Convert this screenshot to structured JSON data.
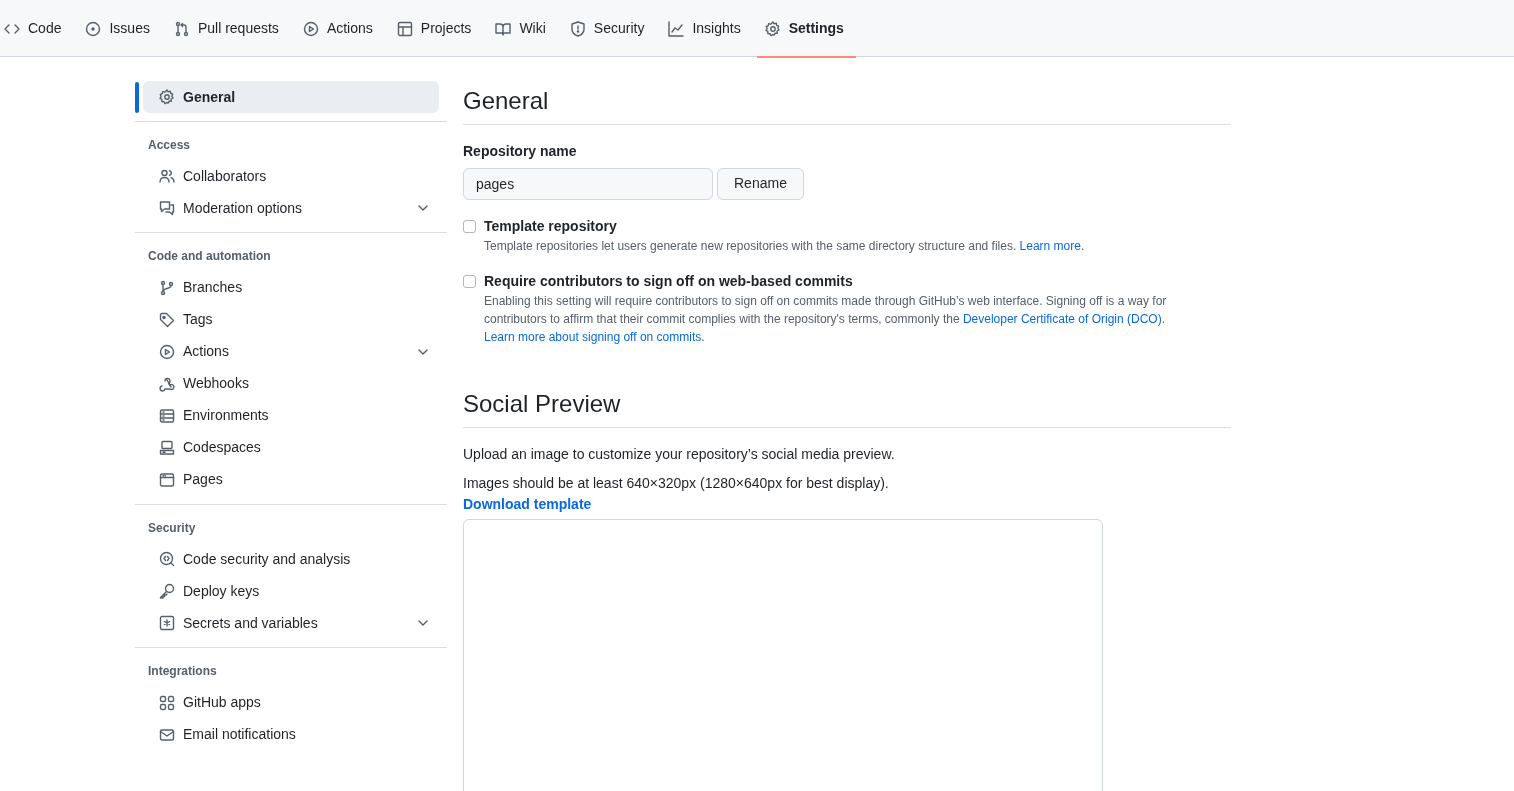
{
  "tabs": [
    {
      "label": "Code",
      "selected": false
    },
    {
      "label": "Issues",
      "selected": false
    },
    {
      "label": "Pull requests",
      "selected": false
    },
    {
      "label": "Actions",
      "selected": false
    },
    {
      "label": "Projects",
      "selected": false
    },
    {
      "label": "Wiki",
      "selected": false
    },
    {
      "label": "Security",
      "selected": false
    },
    {
      "label": "Insights",
      "selected": false
    },
    {
      "label": "Settings",
      "selected": true
    }
  ],
  "sidebar": {
    "top_item": {
      "label": "General",
      "selected": true
    },
    "groups": [
      {
        "heading": "Access",
        "items": [
          {
            "label": "Collaborators",
            "selected": false,
            "has_submenu": false
          },
          {
            "label": "Moderation options",
            "selected": false,
            "has_submenu": true
          }
        ]
      },
      {
        "heading": "Code and automation",
        "items": [
          {
            "label": "Branches",
            "selected": false,
            "has_submenu": false
          },
          {
            "label": "Tags",
            "selected": false,
            "has_submenu": false
          },
          {
            "label": "Actions",
            "selected": false,
            "has_submenu": true
          },
          {
            "label": "Webhooks",
            "selected": false,
            "has_submenu": false
          },
          {
            "label": "Environments",
            "selected": false,
            "has_submenu": false
          },
          {
            "label": "Codespaces",
            "selected": false,
            "has_submenu": false
          },
          {
            "label": "Pages",
            "selected": false,
            "has_submenu": false
          }
        ]
      },
      {
        "heading": "Security",
        "items": [
          {
            "label": "Code security and analysis",
            "selected": false,
            "has_submenu": false
          },
          {
            "label": "Deploy keys",
            "selected": false,
            "has_submenu": false
          },
          {
            "label": "Secrets and variables",
            "selected": false,
            "has_submenu": true
          }
        ]
      },
      {
        "heading": "Integrations",
        "items": [
          {
            "label": "GitHub apps",
            "selected": false,
            "has_submenu": false
          },
          {
            "label": "Email notifications",
            "selected": false,
            "has_submenu": false
          }
        ]
      }
    ]
  },
  "general": {
    "title": "General",
    "repo_name_label": "Repository name",
    "repo_name_value": "pages",
    "rename_button": "Rename",
    "options": [
      {
        "label": "Template repository",
        "checked": false,
        "lines": [
          [
            {
              "kind": "text",
              "text": "Template repositories let users generate new repositories with the same directory structure and files. "
            },
            {
              "kind": "link",
              "text": "Learn more"
            },
            {
              "kind": "text",
              "text": "."
            }
          ]
        ]
      },
      {
        "label": "Require contributors to sign off on web-based commits",
        "checked": false,
        "lines": [
          [
            {
              "kind": "text",
              "text": "Enabling this setting will require contributors to sign off on commits made through GitHub’s web interface. Signing off is a way for"
            }
          ],
          [
            {
              "kind": "text",
              "text": "contributors to affirm that their commit complies with the repository's terms, commonly the "
            },
            {
              "kind": "link",
              "text": "Developer Certificate of Origin (DCO)"
            },
            {
              "kind": "text",
              "text": "."
            }
          ],
          [
            {
              "kind": "link",
              "text": "Learn more about signing off on commits"
            },
            {
              "kind": "text",
              "text": "."
            }
          ]
        ]
      }
    ]
  },
  "social_preview": {
    "title": "Social Preview",
    "intro": "Upload an image to customize your repository’s social media preview.",
    "size_note": "Images should be at least 640×320px (1280×640px for best display).",
    "download_link": "Download template"
  }
}
